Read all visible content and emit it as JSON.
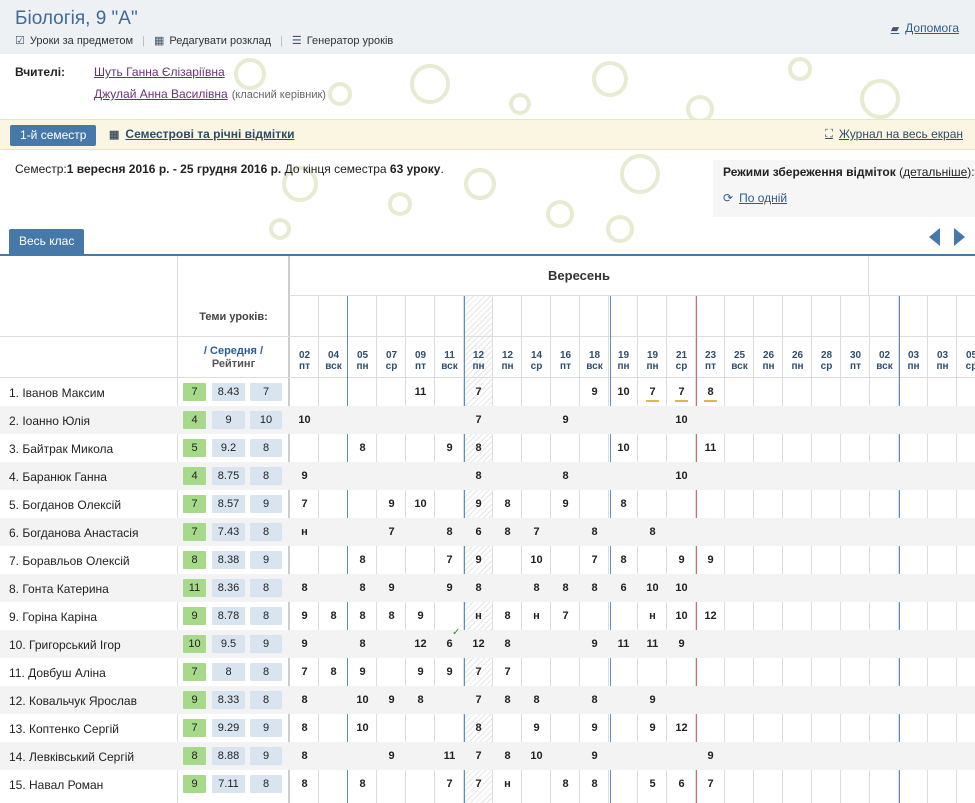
{
  "header": {
    "title": "Біологія, 9 \"А\"",
    "links": [
      "Уроки за предметом",
      "Редагувати розклад",
      "Генератор уроків"
    ],
    "help": "Допомога"
  },
  "teachers": {
    "label": "Вчителі:",
    "list": [
      {
        "name": "Шуть Ганна Єлізаріївна",
        "note": ""
      },
      {
        "name": "Джулай Анна Василівна",
        "note": "(класний керівник)"
      }
    ]
  },
  "semester": {
    "button": "1-й семестр",
    "marks_link": "Семестрові та річні відмітки",
    "fullscreen": "Журнал на весь екран",
    "info_prefix": "Семестр:",
    "range": "1 вересня 2016 р. - 25 грудня 2016 р.",
    "info_mid": " До кінця семестра ",
    "remaining": "63 уроку",
    "info_end": "."
  },
  "save_mode": {
    "title": "Режими збереження відміток",
    "details_open": " (",
    "details": "детальніше",
    "details_close": "):",
    "option": "По одній"
  },
  "tab": "Весь клас",
  "grid": {
    "month": "Вересень",
    "topics_label": "Теми уроків:",
    "avg_label": "/ Середня /",
    "rating_label": "Рейтинг",
    "days": [
      [
        "02",
        "пт"
      ],
      [
        "04",
        "вск"
      ],
      [
        "05",
        "пн"
      ],
      [
        "07",
        "ср"
      ],
      [
        "09",
        "пт"
      ],
      [
        "11",
        "вск"
      ],
      [
        "12",
        "пн"
      ],
      [
        "12",
        "пн"
      ],
      [
        "14",
        "ср"
      ],
      [
        "16",
        "пт"
      ],
      [
        "18",
        "вск"
      ],
      [
        "19",
        "пн"
      ],
      [
        "19",
        "пн"
      ],
      [
        "21",
        "ср"
      ],
      [
        "23",
        "пт"
      ],
      [
        "25",
        "вск"
      ],
      [
        "26",
        "пн"
      ],
      [
        "26",
        "пн"
      ],
      [
        "28",
        "ср"
      ],
      [
        "30",
        "пт"
      ],
      [
        "02",
        "вск"
      ],
      [
        "03",
        "пн"
      ],
      [
        "03",
        "пн"
      ],
      [
        "05",
        "ср"
      ]
    ],
    "students": [
      {
        "name": "1. Іванов Максим",
        "s": [
          "7",
          "8.43",
          "7"
        ],
        "m": [
          "",
          "",
          "",
          "",
          "11",
          "",
          "7",
          "",
          "",
          "",
          "9",
          "10",
          "7",
          "7",
          "8"
        ]
      },
      {
        "name": "2. Іоанно Юлія",
        "s": [
          "4",
          "9",
          "10"
        ],
        "m": [
          "10",
          "",
          "",
          "",
          "",
          "",
          "7",
          "",
          "",
          "9",
          "",
          "",
          "",
          "10",
          ""
        ]
      },
      {
        "name": "3. Байтрак Микола",
        "s": [
          "5",
          "9.2",
          "8"
        ],
        "m": [
          "",
          "",
          "8",
          "",
          "",
          "9",
          "8",
          "",
          "",
          "",
          "",
          "10",
          "",
          "",
          "11"
        ]
      },
      {
        "name": "4. Баранюк Ганна",
        "s": [
          "4",
          "8.75",
          "8"
        ],
        "m": [
          "9",
          "",
          "",
          "",
          "",
          "",
          "8",
          "",
          "",
          "8",
          "",
          "",
          "",
          "10",
          ""
        ]
      },
      {
        "name": "5. Богданов Олексій",
        "s": [
          "7",
          "8.57",
          "9"
        ],
        "m": [
          "7",
          "",
          "",
          "9",
          "10",
          "",
          "9",
          "8",
          "",
          "9",
          "",
          "8",
          "",
          "",
          ""
        ]
      },
      {
        "name": "6. Богданова Анастасія",
        "s": [
          "7",
          "7.43",
          "8"
        ],
        "m": [
          "н",
          "",
          "",
          "7",
          "",
          "8",
          "6",
          "8",
          "7",
          "",
          "8",
          "",
          "8",
          "",
          ""
        ]
      },
      {
        "name": "7. Боравльов Олексій",
        "s": [
          "8",
          "8.38",
          "9"
        ],
        "m": [
          "",
          "",
          "8",
          "",
          "",
          "7",
          "9",
          "",
          "10",
          "",
          "7",
          "8",
          "",
          "9",
          "9"
        ]
      },
      {
        "name": "8. Гонта Катерина",
        "s": [
          "11",
          "8.36",
          "8"
        ],
        "m": [
          "8",
          "",
          "8",
          "9",
          "",
          "9",
          "8",
          "",
          "8",
          "8",
          "8",
          "6",
          "10",
          "10",
          ""
        ]
      },
      {
        "name": "9. Горіна Каріна",
        "s": [
          "9",
          "8.78",
          "8"
        ],
        "m": [
          "9",
          "8",
          "8",
          "8",
          "9",
          "",
          "н",
          "8",
          "н",
          "7",
          "",
          "",
          "н",
          "10",
          "12"
        ]
      },
      {
        "name": "10. Григорський Ігор",
        "s": [
          "10",
          "9.5",
          "9"
        ],
        "m": [
          "9",
          "",
          "8",
          "",
          "12",
          "6",
          "12",
          "8",
          "",
          "",
          "9",
          "11",
          "11",
          "9",
          ""
        ]
      },
      {
        "name": "11. Довбуш Аліна",
        "s": [
          "7",
          "8",
          "8"
        ],
        "m": [
          "7",
          "8",
          "9",
          "",
          "9",
          "9",
          "7",
          "7",
          "",
          "",
          "",
          "",
          "",
          "",
          ""
        ]
      },
      {
        "name": "12. Ковальчук Ярослав",
        "s": [
          "9",
          "8.33",
          "8"
        ],
        "m": [
          "8",
          "",
          "10",
          "9",
          "8",
          "",
          "7",
          "8",
          "8",
          "",
          "8",
          "",
          "9",
          "",
          ""
        ]
      },
      {
        "name": "13. Коптенко Сергій",
        "s": [
          "7",
          "9.29",
          "9"
        ],
        "m": [
          "8",
          "",
          "10",
          "",
          "",
          "",
          "8",
          "",
          "9",
          "",
          "9",
          "",
          "9",
          "12",
          ""
        ]
      },
      {
        "name": "14. Левківський Сергій",
        "s": [
          "8",
          "8.88",
          "9"
        ],
        "m": [
          "8",
          "",
          "",
          "9",
          "",
          "11",
          "7",
          "8",
          "10",
          "",
          "9",
          "",
          "",
          "",
          "9"
        ]
      },
      {
        "name": "15. Навал Роман",
        "s": [
          "9",
          "7.11",
          "8"
        ],
        "m": [
          "8",
          "",
          "8",
          "",
          "",
          "7",
          "7",
          "н",
          "",
          "8",
          "8",
          "",
          "5",
          "6",
          "7"
        ]
      }
    ]
  }
}
